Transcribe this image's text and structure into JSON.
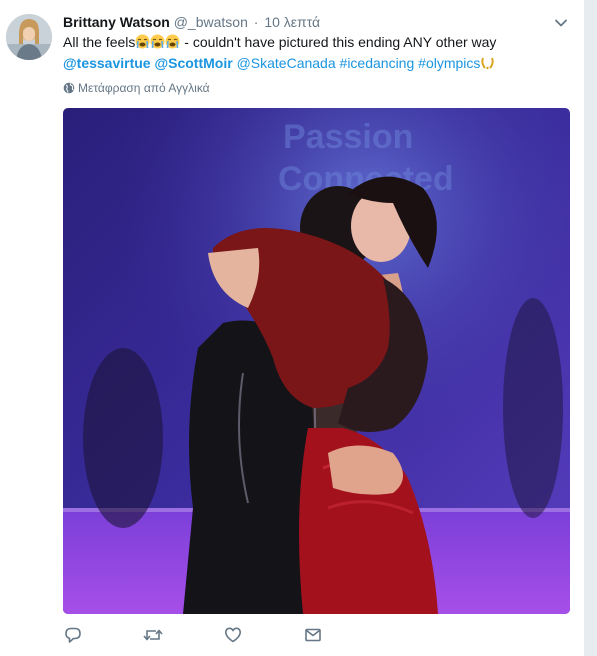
{
  "tweet": {
    "fullname": "Brittany Watson",
    "username": "@_bwatson",
    "separator": "·",
    "time": "10 λεπτά",
    "text_part1": "All the feels",
    "text_part2": "- couldn't have pictured this ending ANY other way",
    "mentions": [
      "@tessavirtue",
      "@ScottMoir",
      "@SkateCanada"
    ],
    "hashtags": [
      "#icedancing",
      "#olympics"
    ],
    "translate_label": "Μετάφραση από Αγγλικά",
    "media_banner_text": "Passion Connected",
    "icons": {
      "caret": "chevron-down-icon",
      "globe": "globe-icon",
      "reply": "reply-icon",
      "retweet": "retweet-icon",
      "like": "heart-icon",
      "dm": "envelope-icon"
    }
  },
  "colors": {
    "link": "#1b95e0",
    "secondary": "#657786",
    "background": "#e6ecf0"
  }
}
